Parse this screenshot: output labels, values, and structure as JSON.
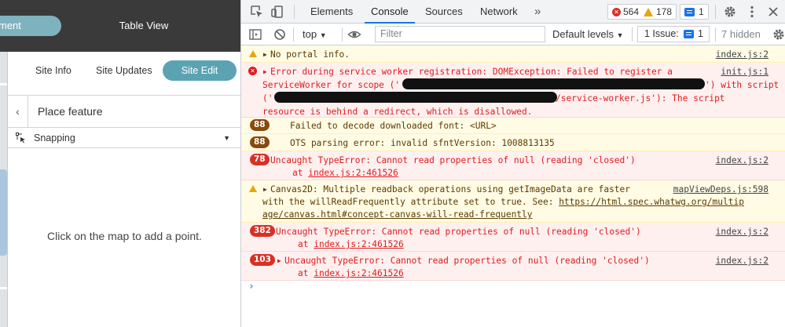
{
  "app": {
    "header_button": "ment",
    "header_title": "Table View",
    "tabs": [
      "Site Info",
      "Site Updates",
      "Site Edit"
    ],
    "active_tab": "Site Edit",
    "place_feature_title": "Place feature",
    "back_glyph": "‹",
    "snapping_label": "Snapping",
    "empty_message": "Click on the map to add a point.",
    "colors": {
      "header": "#3a3a3a",
      "accent": "#5ba3b2"
    }
  },
  "devtools": {
    "tabs": [
      "Elements",
      "Console",
      "Sources",
      "Network"
    ],
    "active_tab": "Console",
    "more_tabs": "»",
    "error_count": "564",
    "warning_count": "178",
    "info_count": "1",
    "context": "top",
    "filter_placeholder": "Filter",
    "levels_label": "Default levels",
    "issues_label": "1 Issue:",
    "issues_count": "1",
    "hidden_label": "7 hidden",
    "icons": [
      "inspect-icon",
      "device-toolbar-icon",
      "gear-icon",
      "more-vert-icon",
      "sidebar-icon",
      "clear-icon",
      "eye-icon",
      "close-icon"
    ]
  },
  "console": {
    "m1": {
      "text": "No portal info.",
      "src": "index.js:2"
    },
    "m2": {
      "l1": "Error during service worker registration: DOMException: Failed to register a",
      "l2a": "ServiceWorker for scope ('",
      "l2b": "') with script",
      "l3a": "('",
      "l3b": "/service-worker.js'): The script",
      "l4": "resource is behind a redirect, which is disallowed.",
      "src": "init.js:1"
    },
    "m3": {
      "count": "88",
      "text": "Failed to decode downloaded font: <URL>"
    },
    "m4": {
      "count": "88",
      "text": "OTS parsing error: invalid sfntVersion: 1008813135"
    },
    "m5": {
      "count": "78",
      "l1": "Uncaught TypeError: Cannot read properties of null (reading 'closed')",
      "l2": "at ",
      "l2link": "index.js:2:461526",
      "src": "index.js:2"
    },
    "m6": {
      "l1": "Canvas2D: Multiple readback operations using getImageData are faster",
      "l2a": "with the willReadFrequently attribute set to true. See: ",
      "l2link": "https://html.spec.whatwg.org/multip",
      "l3link": "age/canvas.html#concept-canvas-will-read-frequently",
      "src": "mapViewDeps.js:598"
    },
    "m7": {
      "count": "382",
      "l1": "Uncaught TypeError: Cannot read properties of null (reading 'closed')",
      "l2": "at ",
      "l2link": "index.js:2:461526",
      "src": "index.js:2"
    },
    "m8": {
      "count": "103",
      "l1": "Uncaught TypeError: Cannot read properties of null (reading 'closed')",
      "l2": "at ",
      "l2link": "index.js:2:461526",
      "src": "index.js:2"
    },
    "prompt": "›"
  }
}
